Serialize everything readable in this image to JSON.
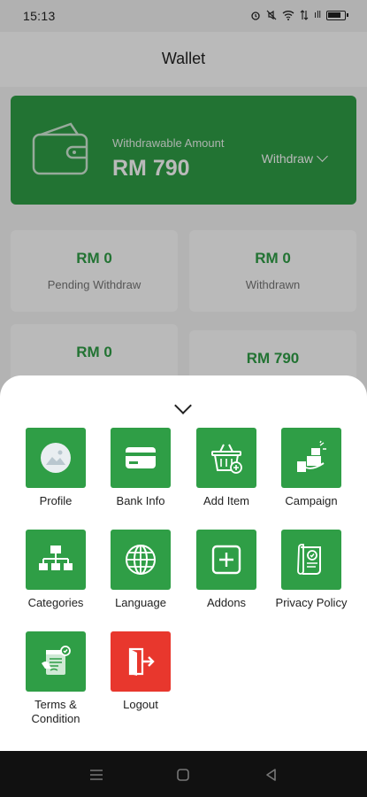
{
  "status_bar": {
    "time": "15:13",
    "signal_text": "ıll"
  },
  "app_bar": {
    "title": "Wallet"
  },
  "wallet": {
    "label": "Withdrawable Amount",
    "amount": "RM 790",
    "withdraw_label": "Withdraw",
    "accent_color": "#2f9e46"
  },
  "stats": [
    {
      "value": "RM 0",
      "label": "Pending Withdraw"
    },
    {
      "value": "RM 0",
      "label": "Withdrawn"
    },
    {
      "value": "RM 0",
      "label": ""
    },
    {
      "value": "RM 790",
      "label": ""
    }
  ],
  "menu": {
    "items": [
      {
        "label": "Profile",
        "icon": "profile-image-icon"
      },
      {
        "label": "Bank Info",
        "icon": "credit-card-icon"
      },
      {
        "label": "Add Item",
        "icon": "basket-add-icon"
      },
      {
        "label": "Campaign",
        "icon": "campaign-icon"
      },
      {
        "label": "Categories",
        "icon": "hierarchy-icon"
      },
      {
        "label": "Language",
        "icon": "globe-icon"
      },
      {
        "label": "Addons",
        "icon": "plus-square-icon"
      },
      {
        "label": "Privacy Policy",
        "icon": "policy-scroll-icon"
      },
      {
        "label": "Terms &\nCondition",
        "icon": "terms-document-icon"
      },
      {
        "label": "Logout",
        "icon": "logout-icon"
      }
    ]
  },
  "colors": {
    "tile_green": "#2f9e46",
    "logout_red": "#e8372d"
  }
}
